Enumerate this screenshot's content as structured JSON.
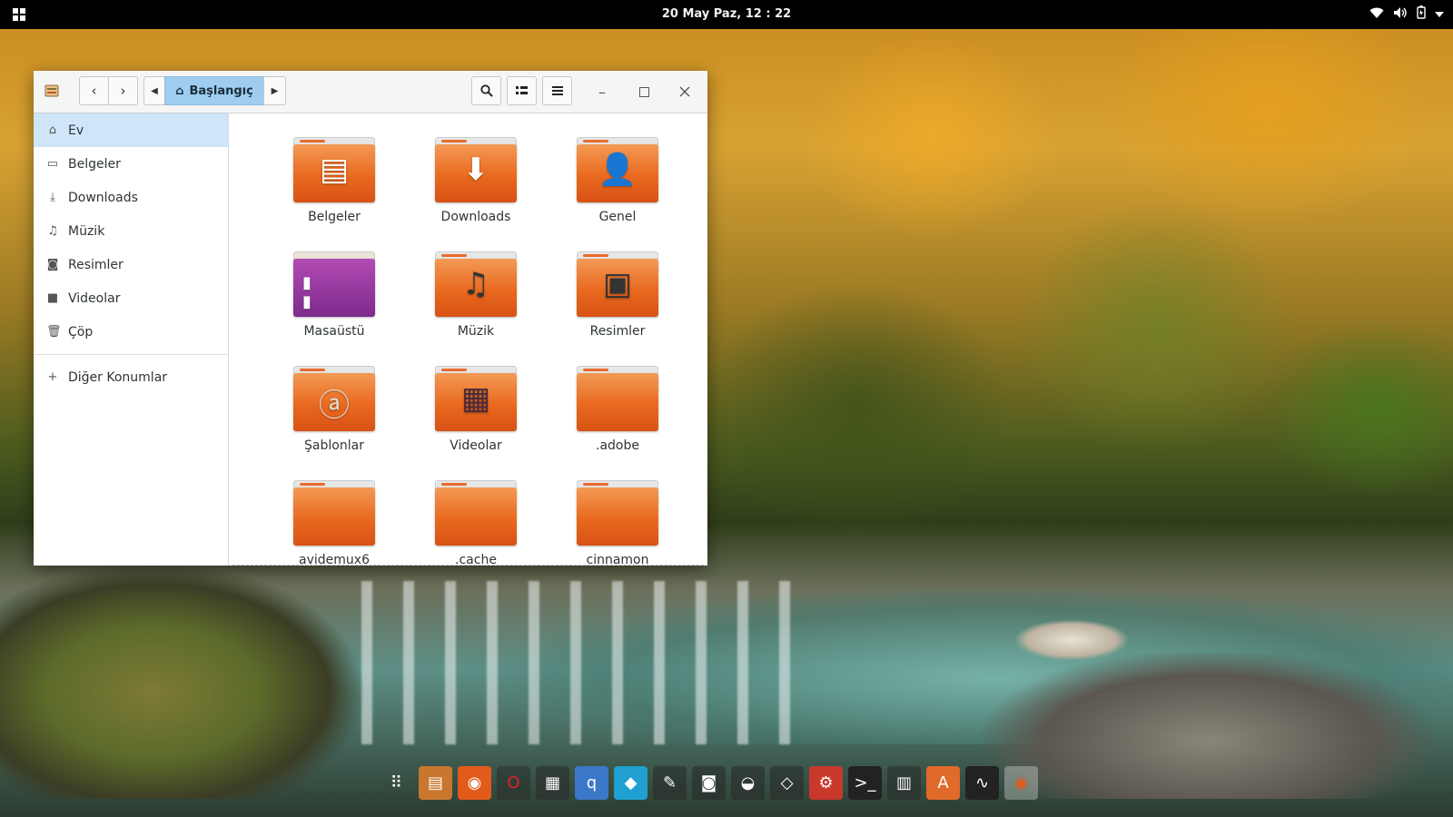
{
  "topbar": {
    "clock": "20 May Paz, 12 : 22"
  },
  "window": {
    "path_label": "Başlangıç"
  },
  "sidebar": {
    "items": [
      {
        "label": "Ev",
        "icon": "home-icon"
      },
      {
        "label": "Belgeler",
        "icon": "document-icon"
      },
      {
        "label": "Downloads",
        "icon": "download-icon"
      },
      {
        "label": "Müzik",
        "icon": "music-icon"
      },
      {
        "label": "Resimler",
        "icon": "camera-icon"
      },
      {
        "label": "Videolar",
        "icon": "video-icon"
      },
      {
        "label": "Çöp",
        "icon": "trash-icon"
      }
    ],
    "other_locations": "Diğer Konumlar"
  },
  "files": [
    {
      "name": "Belgeler",
      "emblem": "document"
    },
    {
      "name": "Downloads",
      "emblem": "download"
    },
    {
      "name": "Genel",
      "emblem": "person"
    },
    {
      "name": "Masaüstü",
      "emblem": "desktop"
    },
    {
      "name": "Müzik",
      "emblem": "music"
    },
    {
      "name": "Resimler",
      "emblem": "pictures"
    },
    {
      "name": "Şablonlar",
      "emblem": "templates"
    },
    {
      "name": "Videolar",
      "emblem": "video"
    },
    {
      "name": ".adobe",
      "emblem": "none"
    },
    {
      "name": "avidemux6",
      "emblem": "none"
    },
    {
      "name": ".cache",
      "emblem": "none"
    },
    {
      "name": "cinnamon",
      "emblem": "none"
    }
  ],
  "dock": [
    "apps-grid-icon",
    "files-icon",
    "firefox-icon",
    "opera-icon",
    "calculator-icon",
    "qbittorrent-icon",
    "kodi-icon",
    "gimp-icon",
    "screenshot-icon",
    "disks-icon",
    "games-icon",
    "settings-icon",
    "terminal-icon",
    "keyboard-icon",
    "software-icon",
    "system-monitor-icon",
    "firefox-active-icon"
  ],
  "colors": {
    "accent_selection": "#cfe6fa",
    "path_button": "#9ecdf0",
    "folder_orange": "#e9691f",
    "topbar": "#000000"
  }
}
